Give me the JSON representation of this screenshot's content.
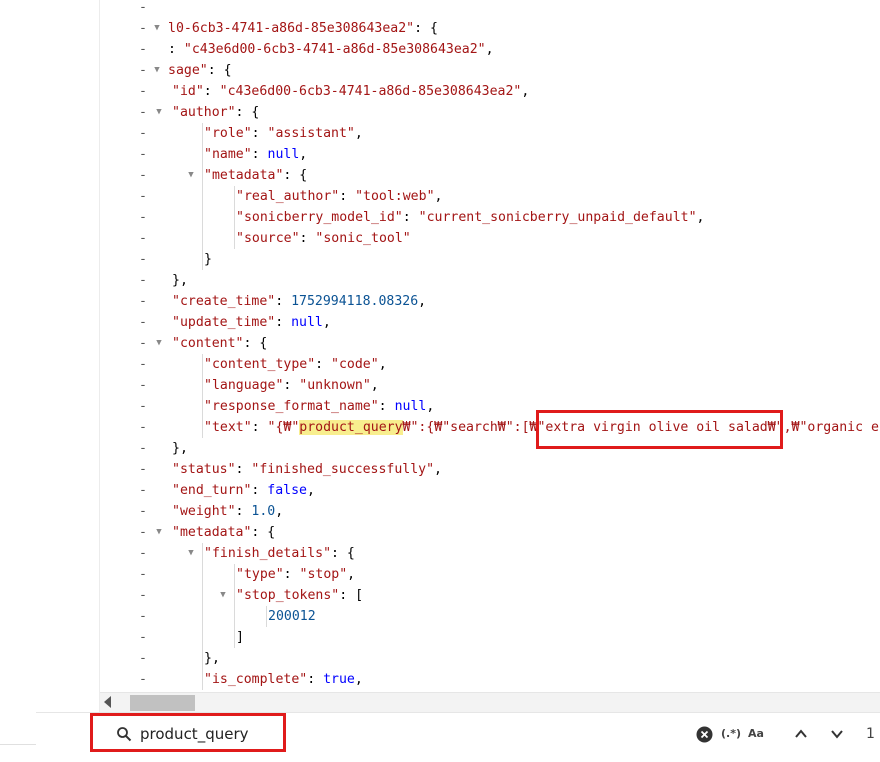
{
  "find": {
    "query": "product_query",
    "match_count": "1",
    "regex_label": "(.*)",
    "case_label": "Aa"
  },
  "icons": {
    "search": "search-icon",
    "clear": "clear-icon",
    "regex": "regex-toggle-icon",
    "case": "match-case-icon",
    "prev": "chevron-up-icon",
    "next": "chevron-down-icon"
  },
  "colors": {
    "highlight": "#f8ee8e",
    "annotation": "#e01b1b",
    "key": "#a31515",
    "number": "#0b5394",
    "keyword": "#0000ff"
  },
  "lines": [
    {
      "tokens": [
        {
          "t": "",
          "c": "p"
        }
      ]
    },
    {
      "tokens": [
        {
          "t": "l0-6cb3-4741-a86d-85e308643ea2\"",
          "c": "k"
        },
        {
          "t": ": {",
          "c": "p"
        }
      ]
    },
    {
      "tokens": [
        {
          "t": ": ",
          "c": "p"
        },
        {
          "t": "\"c43e6d00-6cb3-4741-a86d-85e308643ea2\"",
          "c": "s"
        },
        {
          "t": ",",
          "c": "p"
        }
      ]
    },
    {
      "tokens": [
        {
          "t": "sage\"",
          "c": "k"
        },
        {
          "t": ": {",
          "c": "p"
        }
      ]
    },
    {
      "tokens": [
        {
          "t": "\"id\"",
          "c": "k"
        },
        {
          "t": ": ",
          "c": "p"
        },
        {
          "t": "\"c43e6d00-6cb3-4741-a86d-85e308643ea2\"",
          "c": "s"
        },
        {
          "t": ",",
          "c": "p"
        }
      ]
    },
    {
      "tokens": [
        {
          "t": "\"author\"",
          "c": "k"
        },
        {
          "t": ": {",
          "c": "p"
        }
      ]
    },
    {
      "tokens": [
        {
          "t": "\"role\"",
          "c": "k"
        },
        {
          "t": ": ",
          "c": "p"
        },
        {
          "t": "\"assistant\"",
          "c": "s"
        },
        {
          "t": ",",
          "c": "p"
        }
      ]
    },
    {
      "tokens": [
        {
          "t": "\"name\"",
          "c": "k"
        },
        {
          "t": ": ",
          "c": "p"
        },
        {
          "t": "null",
          "c": "kw"
        },
        {
          "t": ",",
          "c": "p"
        }
      ]
    },
    {
      "tokens": [
        {
          "t": "\"metadata\"",
          "c": "k"
        },
        {
          "t": ": {",
          "c": "p"
        }
      ]
    },
    {
      "tokens": [
        {
          "t": "\"real_author\"",
          "c": "k"
        },
        {
          "t": ": ",
          "c": "p"
        },
        {
          "t": "\"tool:web\"",
          "c": "s"
        },
        {
          "t": ",",
          "c": "p"
        }
      ]
    },
    {
      "tokens": [
        {
          "t": "\"sonicberry_model_id\"",
          "c": "k"
        },
        {
          "t": ": ",
          "c": "p"
        },
        {
          "t": "\"current_sonicberry_unpaid_default\"",
          "c": "s"
        },
        {
          "t": ",",
          "c": "p"
        }
      ]
    },
    {
      "tokens": [
        {
          "t": "\"source\"",
          "c": "k"
        },
        {
          "t": ": ",
          "c": "p"
        },
        {
          "t": "\"sonic_tool\"",
          "c": "s"
        }
      ]
    },
    {
      "tokens": [
        {
          "t": "}",
          "c": "p"
        }
      ]
    },
    {
      "tokens": [
        {
          "t": "},",
          "c": "p"
        }
      ]
    },
    {
      "tokens": [
        {
          "t": "\"create_time\"",
          "c": "k"
        },
        {
          "t": ": ",
          "c": "p"
        },
        {
          "t": "1752994118.08326",
          "c": "n"
        },
        {
          "t": ",",
          "c": "p"
        }
      ]
    },
    {
      "tokens": [
        {
          "t": "\"update_time\"",
          "c": "k"
        },
        {
          "t": ": ",
          "c": "p"
        },
        {
          "t": "null",
          "c": "kw"
        },
        {
          "t": ",",
          "c": "p"
        }
      ]
    },
    {
      "tokens": [
        {
          "t": "\"content\"",
          "c": "k"
        },
        {
          "t": ": {",
          "c": "p"
        }
      ]
    },
    {
      "tokens": [
        {
          "t": "\"content_type\"",
          "c": "k"
        },
        {
          "t": ": ",
          "c": "p"
        },
        {
          "t": "\"code\"",
          "c": "s"
        },
        {
          "t": ",",
          "c": "p"
        }
      ]
    },
    {
      "tokens": [
        {
          "t": "\"language\"",
          "c": "k"
        },
        {
          "t": ": ",
          "c": "p"
        },
        {
          "t": "\"unknown\"",
          "c": "s"
        },
        {
          "t": ",",
          "c": "p"
        }
      ]
    },
    {
      "tokens": [
        {
          "t": "\"response_format_name\"",
          "c": "k"
        },
        {
          "t": ": ",
          "c": "p"
        },
        {
          "t": "null",
          "c": "kw"
        },
        {
          "t": ",",
          "c": "p"
        }
      ]
    },
    {
      "tokens": [
        {
          "t": "\"text\"",
          "c": "k"
        },
        {
          "t": ": ",
          "c": "p"
        },
        {
          "t": "\"{₩\"",
          "c": "s"
        },
        {
          "t": "product_query",
          "c": "s hl"
        },
        {
          "t": "₩\":{₩\"search₩\":[₩\"extra virgin olive oil salad₩\",₩\"organic e",
          "c": "s"
        }
      ]
    },
    {
      "tokens": [
        {
          "t": "},",
          "c": "p"
        }
      ]
    },
    {
      "tokens": [
        {
          "t": "\"status\"",
          "c": "k"
        },
        {
          "t": ": ",
          "c": "p"
        },
        {
          "t": "\"finished_successfully\"",
          "c": "s"
        },
        {
          "t": ",",
          "c": "p"
        }
      ]
    },
    {
      "tokens": [
        {
          "t": "\"end_turn\"",
          "c": "k"
        },
        {
          "t": ": ",
          "c": "p"
        },
        {
          "t": "false",
          "c": "kw"
        },
        {
          "t": ",",
          "c": "p"
        }
      ]
    },
    {
      "tokens": [
        {
          "t": "\"weight\"",
          "c": "k"
        },
        {
          "t": ": ",
          "c": "p"
        },
        {
          "t": "1.0",
          "c": "n"
        },
        {
          "t": ",",
          "c": "p"
        }
      ]
    },
    {
      "tokens": [
        {
          "t": "\"metadata\"",
          "c": "k"
        },
        {
          "t": ": {",
          "c": "p"
        }
      ]
    },
    {
      "tokens": [
        {
          "t": "\"finish_details\"",
          "c": "k"
        },
        {
          "t": ": {",
          "c": "p"
        }
      ]
    },
    {
      "tokens": [
        {
          "t": "\"type\"",
          "c": "k"
        },
        {
          "t": ": ",
          "c": "p"
        },
        {
          "t": "\"stop\"",
          "c": "s"
        },
        {
          "t": ",",
          "c": "p"
        }
      ]
    },
    {
      "tokens": [
        {
          "t": "\"stop_tokens\"",
          "c": "k"
        },
        {
          "t": ": [",
          "c": "p"
        }
      ]
    },
    {
      "tokens": [
        {
          "t": "200012",
          "c": "n"
        }
      ]
    },
    {
      "tokens": [
        {
          "t": "]",
          "c": "p"
        }
      ]
    },
    {
      "tokens": [
        {
          "t": "},",
          "c": "p"
        }
      ]
    },
    {
      "tokens": [
        {
          "t": "\"is_complete\"",
          "c": "k"
        },
        {
          "t": ": ",
          "c": "p"
        },
        {
          "t": "true",
          "c": "kw"
        },
        {
          "t": ",",
          "c": "p"
        }
      ]
    }
  ]
}
